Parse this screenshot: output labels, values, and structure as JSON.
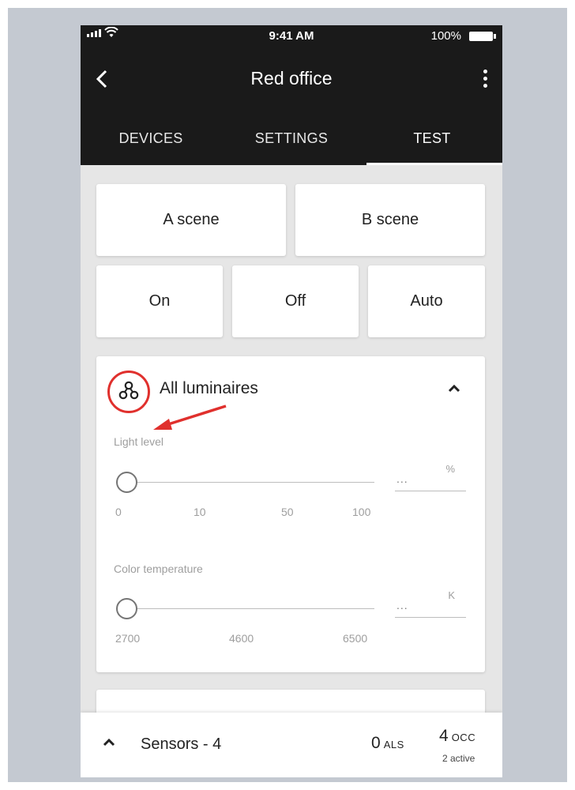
{
  "status_bar": {
    "time": "9:41 AM",
    "battery": "100%"
  },
  "app_bar": {
    "title": "Red office"
  },
  "tabs": [
    {
      "label": "DEVICES",
      "active": false
    },
    {
      "label": "SETTINGS",
      "active": false
    },
    {
      "label": "TEST",
      "active": true
    }
  ],
  "scenes": {
    "a": "A scene",
    "b": "B scene"
  },
  "modes": {
    "on": "On",
    "off": "Off",
    "auto": "Auto"
  },
  "luminaires": {
    "title": "All luminaires",
    "light_level": {
      "label": "Light level",
      "ticks": [
        "0",
        "10",
        "50",
        "100"
      ],
      "value": "...",
      "unit": "%"
    },
    "color_temperature": {
      "label": "Color temperature",
      "ticks": [
        "2700",
        "4600",
        "6500"
      ],
      "value": "...",
      "unit": "K"
    }
  },
  "bottom_bar": {
    "label": "Sensors - 4",
    "als_value": "0",
    "als_unit": "ALS",
    "occ_value": "4",
    "occ_unit": "OCC",
    "occ_active": "2 active"
  },
  "colors": {
    "app_bar": "#1a1a1a",
    "annotation": "#e0302d",
    "background": "#c4c9d1"
  },
  "icons": [
    "back-arrow-icon",
    "more-vert-icon",
    "luminaire-group-icon",
    "chevron-up-icon",
    "annotation-arrow-icon"
  ]
}
